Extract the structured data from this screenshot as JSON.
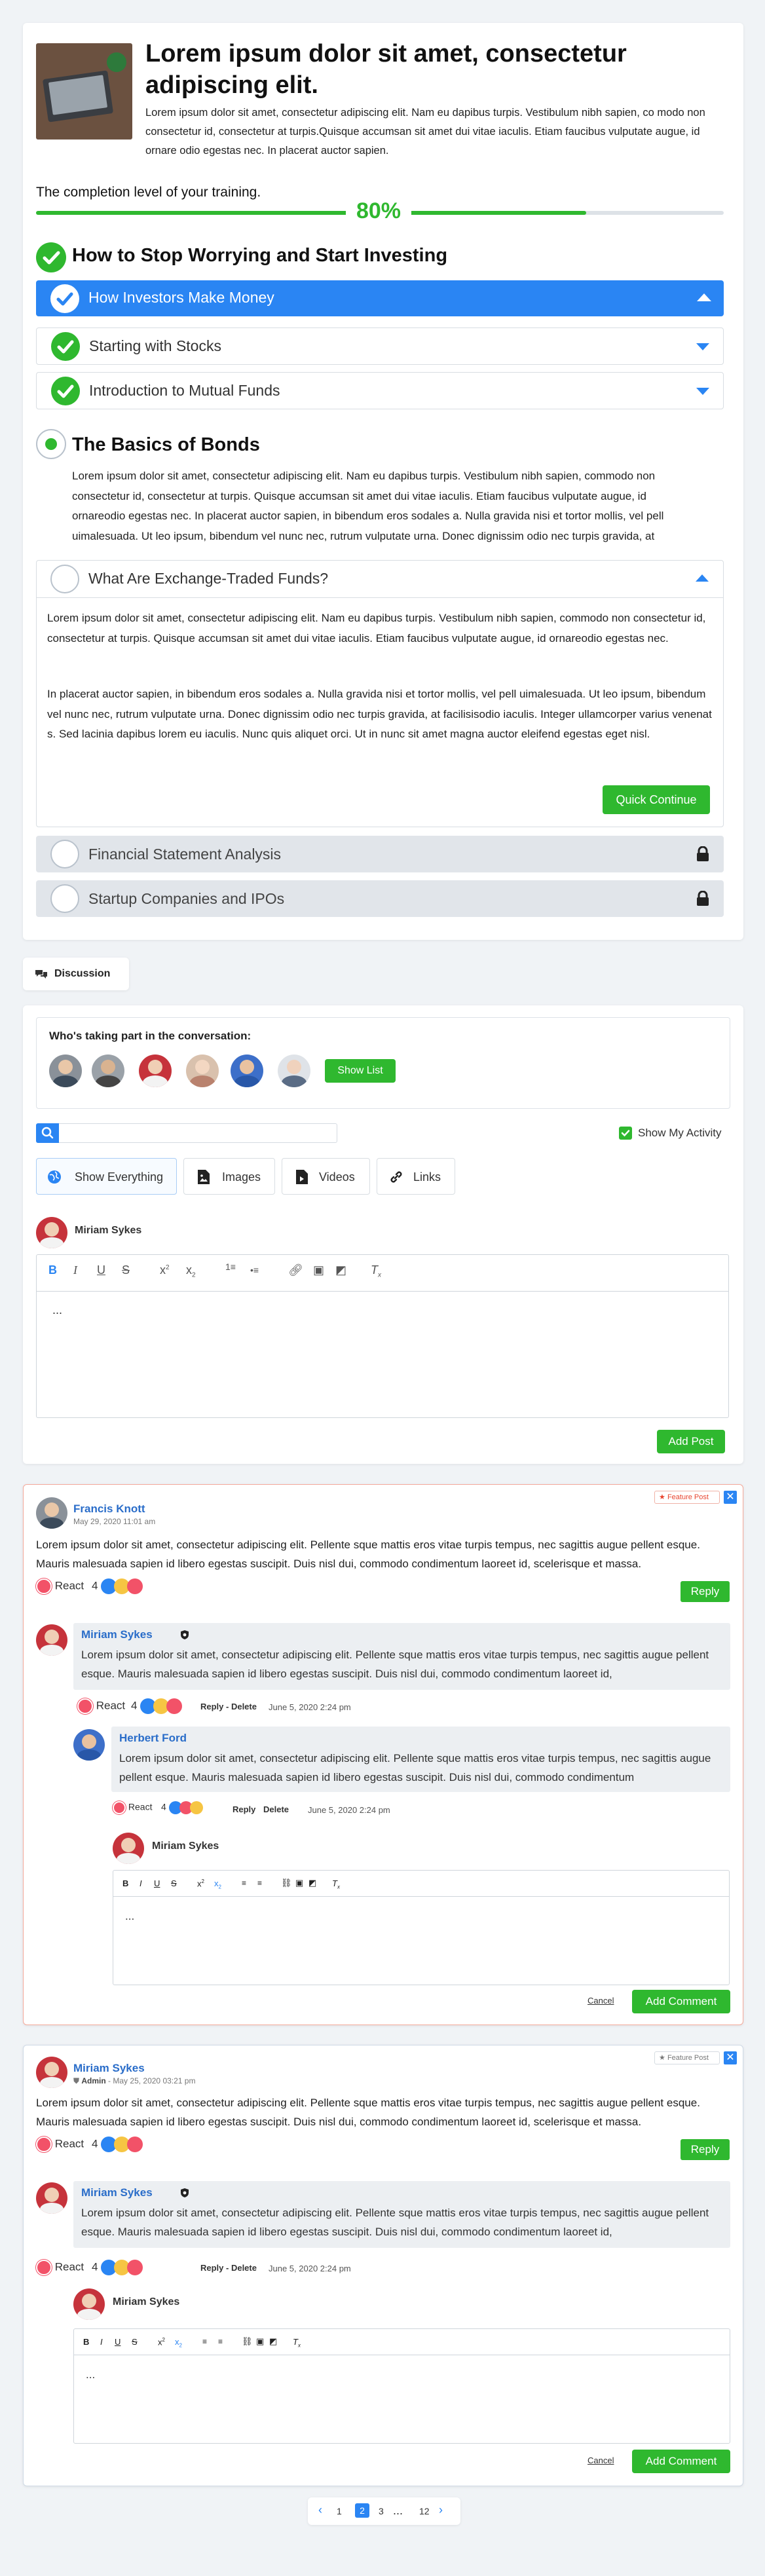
{
  "header": {
    "title": "Lorem ipsum dolor sit amet, consectetur adipiscing elit.",
    "description": "Lorem ipsum dolor sit amet, consectetur adipiscing elit. Nam eu dapibus turpis. Vestibulum nibh sapien, co modo non consectetur id, consectetur at turpis.Quisque accumsan sit amet dui vitae iaculis. Etiam faucibus vulputate augue, id ornare odio egestas nec. In placerat auctor sapien."
  },
  "progress": {
    "label": "The completion level of your training.",
    "percent_text": "80%",
    "value": 0.8
  },
  "sections": [
    {
      "title": "How to Stop Worrying and Start Investing",
      "lessons": [
        {
          "label": "How Investors Make Money",
          "state": "active"
        },
        {
          "label": "Starting with Stocks",
          "state": "done"
        },
        {
          "label": "Introduction to Mutual Funds",
          "state": "done"
        }
      ]
    },
    {
      "title": "The Basics of Bonds",
      "text": "Lorem ipsum dolor sit amet, consectetur adipiscing elit. Nam eu dapibus turpis. Vestibulum nibh sapien, commodo non consectetur id, consectetur at turpis. Quisque accumsan sit amet dui vitae iaculis. Etiam faucibus vulputate augue, id ornareodio egestas nec. In placerat auctor sapien, in bibendum eros sodales a. Nulla gravida nisi et tortor mollis, vel pell uimalesuada. Ut leo ipsum, bibendum vel nunc nec, rutrum vulputate urna. Donec dignissim odio nec turpis gravida, at"
    }
  ],
  "open_lesson": {
    "label": "What Are Exchange-Traded Funds?",
    "para1": "Lorem ipsum dolor sit amet, consectetur adipiscing elit. Nam eu dapibus turpis. Vestibulum nibh sapien, commodo non consectetur id, consectetur at turpis. Quisque accumsan sit amet dui vitae iaculis. Etiam faucibus vulputate augue, id ornareodio egestas nec.",
    "para2": "In placerat auctor sapien, in bibendum eros sodales a. Nulla gravida nisi et tortor mollis, vel pell uimalesuada. Ut leo ipsum, bibendum vel nunc nec, rutrum vulputate urna. Donec dignissim odio nec turpis gravida, at facilisisodio iaculis. Integer ullamcorper varius venenat s. Sed lacinia dapibus lorem eu iaculis. Nunc quis aliquet orci. Ut in nunc sit amet magna auctor eleifend egestas eget nisl.",
    "button": "Quick Continue"
  },
  "locked_lessons": [
    "Financial Statement Analysis",
    "Startup Companies and IPOs"
  ],
  "discussion": {
    "tab": "Discussion",
    "participants_label": "Who's taking part in the conversation:",
    "show_list": "Show List",
    "show_activity": "Show My Activity",
    "filters": [
      "Show Everything",
      "Images",
      "Videos",
      "Links"
    ],
    "composer_user": "Miriam Sykes",
    "composer_placeholder": "...",
    "add_post": "Add Post"
  },
  "posts": [
    {
      "author": "Francis Knott",
      "date": "May 29, 2020 11:01 am",
      "badge": "Feature Post",
      "text": "Lorem ipsum dolor sit amet, consectetur adipiscing elit. Pellente sque mattis eros vitae turpis tempus, nec sagittis augue pellent esque. Mauris malesuada sapien id libero egestas suscipit. Duis nisl dui, commodo condimentum laoreet id, scelerisque et massa.",
      "react": "React",
      "react_count": "4",
      "reply": "Reply",
      "replies": [
        {
          "author": "Miriam Sykes",
          "text": "Lorem ipsum dolor sit amet, consectetur adipiscing elit. Pellente sque mattis eros vitae turpis tempus, nec sagittis augue pellent esque. Mauris malesuada sapien id libero egestas suscipit. Duis nisl dui, commodo condimentum laoreet id,",
          "react": "React",
          "react_count": "4",
          "actions": "Reply - Delete",
          "date": "June 5, 2020 2:24 pm"
        },
        {
          "author": "Herbert Ford",
          "text": "Lorem ipsum dolor sit amet, consectetur adipiscing elit. Pellente sque mattis eros vitae turpis tempus, nec sagittis augue pellent esque. Mauris malesuada sapien id libero egestas suscipit. Duis nisl dui, commodo condimentum",
          "react": "React",
          "react_count": "4",
          "reply": "Reply",
          "delete": "Delete",
          "date": "June 5, 2020 2:24 pm"
        }
      ],
      "composer_user": "Miriam Sykes",
      "composer_placeholder": "...",
      "cancel": "Cancel",
      "add_comment": "Add Comment"
    },
    {
      "author": "Miriam Sykes",
      "role": "Admin",
      "date": "May 25, 2020 03:21 pm",
      "badge": "Feature Post",
      "text": "Lorem ipsum dolor sit amet, consectetur adipiscing elit. Pellente sque mattis eros vitae turpis tempus, nec sagittis augue pellent esque. Mauris malesuada sapien id libero egestas suscipit. Duis nisl dui, commodo condimentum laoreet id, scelerisque et massa.",
      "react": "React",
      "react_count": "4",
      "reply": "Reply",
      "replies": [
        {
          "author": "Miriam Sykes",
          "text": "Lorem ipsum dolor sit amet, consectetur adipiscing elit. Pellente sque mattis eros vitae turpis tempus, nec sagittis augue pellent esque. Mauris malesuada sapien id libero egestas suscipit. Duis nisl dui, commodo condimentum laoreet id,",
          "react": "React",
          "react_count": "4",
          "actions": "Reply - Delete",
          "date": "June 5, 2020 2:24 pm"
        }
      ],
      "composer_user": "Miriam Sykes",
      "composer_placeholder": "...",
      "cancel": "Cancel",
      "add_comment": "Add Comment"
    }
  ],
  "pagination": {
    "pages": [
      "1",
      "2",
      "3",
      "...",
      "12"
    ],
    "current": "2"
  },
  "colors": {
    "green": "#2fb82f",
    "blue": "#2a85f3",
    "link_blue": "#2a6dc9",
    "feature_red": "#e8442e"
  }
}
